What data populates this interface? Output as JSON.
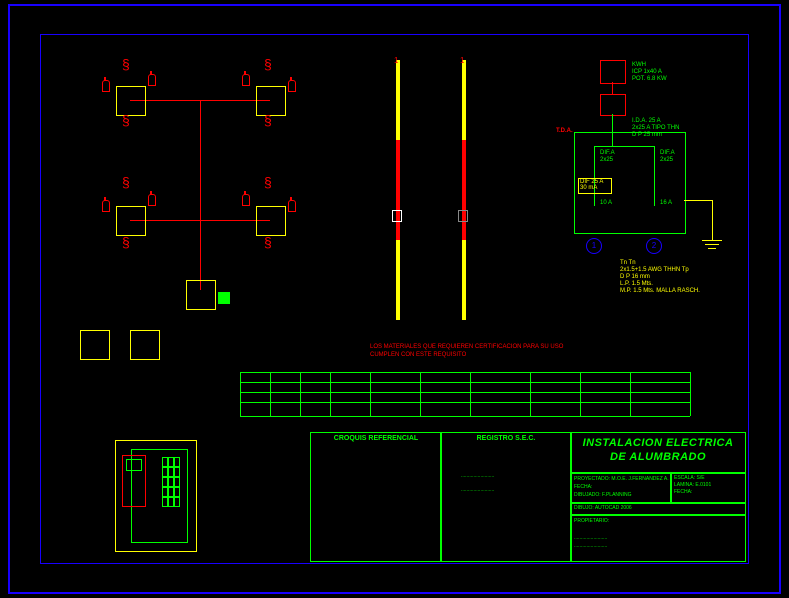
{
  "title": {
    "line1": "INSTALACION ELECTRICA",
    "line2": "DE ALUMBRADO"
  },
  "titleblock": {
    "croquis_label": "CROQUIS REFERENCIAL",
    "registro_label": "REGISTRO S.E.C.",
    "reg_line1": "........................",
    "reg_line2": "........................",
    "left_line1": "PROYECTADO: M.O.E. J.FERNANDEZ A.",
    "left_line2": "FECHA:",
    "left_line3": "DIBUJADO:   F.PLANNING",
    "right_line1": "ESCALA: S/E",
    "right_line2": "LAMINA: E.0101",
    "right_line3": "FECHA:",
    "right_line4": "DIBUJO: AUTOCAD 2006",
    "prop_label": "PROPIETARIO:",
    "owner_name": "........................",
    "owner_addr": "........................"
  },
  "note_line1": "LOS MATERIALES QUE REQUIEREN CERTIFICACION PARA SU USO",
  "note_line2": "CUMPLEN CON ESTE REQUISITO",
  "sld": {
    "kwh": "KWH",
    "icp": "ICP 1x40 A",
    "pot": "POT. 6.8 KW",
    "tda": "T.D.A.",
    "ida_line1": "I.D.A. 25 A",
    "ida_line2": "2x25 A TIPO THN",
    "ida_line3": "D P   25 mm",
    "d1": "DIF.A",
    "d1b": "2x25",
    "d2": "DIF.A",
    "d2b": "2x25",
    "a1": "10 A",
    "a2": "16 A",
    "diff": "DIF 25 A",
    "diff2": "30 mA",
    "c1": "1",
    "c2": "2",
    "spec1": "Tn       Tn",
    "spec2": "2x1.5+1.5 AWG THHN Tp",
    "spec3": "D P  16 mm",
    "spec4": "L.P. 1.5 Mts.",
    "spec5": "M.P. 1.5 Mts.  MALLA RASCH."
  },
  "riser": {
    "r1": "1",
    "r2": "1"
  }
}
